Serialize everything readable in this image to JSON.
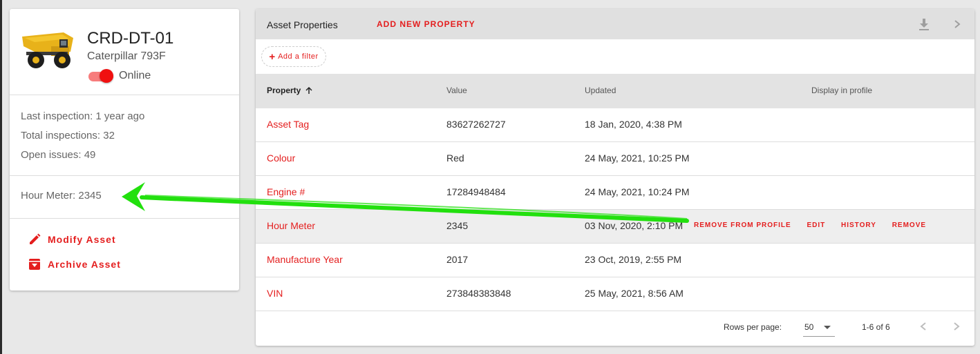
{
  "asset": {
    "name": "CRD-DT-01",
    "model": "Caterpillar 793F",
    "status": "Online",
    "online": true,
    "stats": [
      "Last inspection: 1 year ago",
      "Total inspections: 32",
      "Open issues: 49"
    ],
    "hour_meter": "Hour Meter: 2345",
    "actions": {
      "modify": "Modify Asset",
      "archive": "Archive Asset"
    }
  },
  "panel": {
    "title": "Asset Properties",
    "add_property": "ADD NEW PROPERTY",
    "filter": "Add a filter",
    "columns": [
      "Property",
      "Value",
      "Updated",
      "Display in profile"
    ],
    "rows": [
      {
        "property": "Asset Tag",
        "value": "83627262727",
        "updated": "18 Jan, 2020, 4:38 PM"
      },
      {
        "property": "Colour",
        "value": "Red",
        "updated": "24 May, 2021, 10:25 PM"
      },
      {
        "property": "Engine #",
        "value": "17284948484",
        "updated": "24 May, 2021, 10:24 PM"
      },
      {
        "property": "Hour Meter",
        "value": "2345",
        "updated": "03 Nov, 2020, 2:10 PM"
      },
      {
        "property": "Manufacture Year",
        "value": "2017",
        "updated": "23 Oct, 2019, 2:55 PM"
      },
      {
        "property": "VIN",
        "value": "273848383848",
        "updated": "25 May, 2021, 8:56 AM"
      }
    ],
    "row_actions": [
      "REMOVE FROM PROFILE",
      "EDIT",
      "HISTORY",
      "REMOVE"
    ],
    "pagination": {
      "rows_per_page_label": "Rows per page:",
      "rows_per_page": "50",
      "range": "1-6 of 6"
    }
  },
  "colors": {
    "accent": "#e41e1e",
    "annotation": "#22e00e"
  }
}
